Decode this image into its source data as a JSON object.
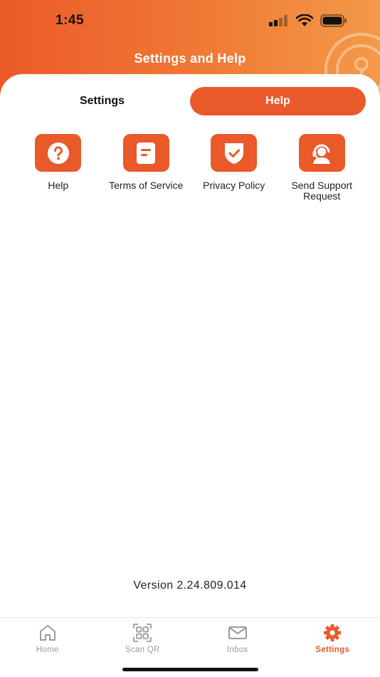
{
  "status_bar": {
    "time": "1:45"
  },
  "header": {
    "title": "Settings and Help"
  },
  "tabs": [
    {
      "label": "Settings",
      "active": false
    },
    {
      "label": "Help",
      "active": true
    }
  ],
  "help_items": [
    {
      "label": "Help",
      "icon": "question-circle-icon"
    },
    {
      "label": "Terms of Service",
      "icon": "document-icon"
    },
    {
      "label": "Privacy Policy",
      "icon": "shield-check-icon"
    },
    {
      "label": "Send Support Request",
      "icon": "support-agent-icon"
    }
  ],
  "version": "Version 2.24.809.014",
  "bottom_nav": [
    {
      "label": "Home",
      "icon": "home-icon",
      "active": false
    },
    {
      "label": "Scan QR",
      "icon": "qr-scan-icon",
      "active": false
    },
    {
      "label": "Inbox",
      "icon": "mail-icon",
      "active": false
    },
    {
      "label": "Settings",
      "icon": "gear-icon",
      "active": true
    }
  ],
  "colors": {
    "accent": "#e9592a",
    "header_gradient_start": "#ec5a29",
    "header_gradient_end": "#f39a48",
    "inactive_nav": "#9a9a9a"
  }
}
